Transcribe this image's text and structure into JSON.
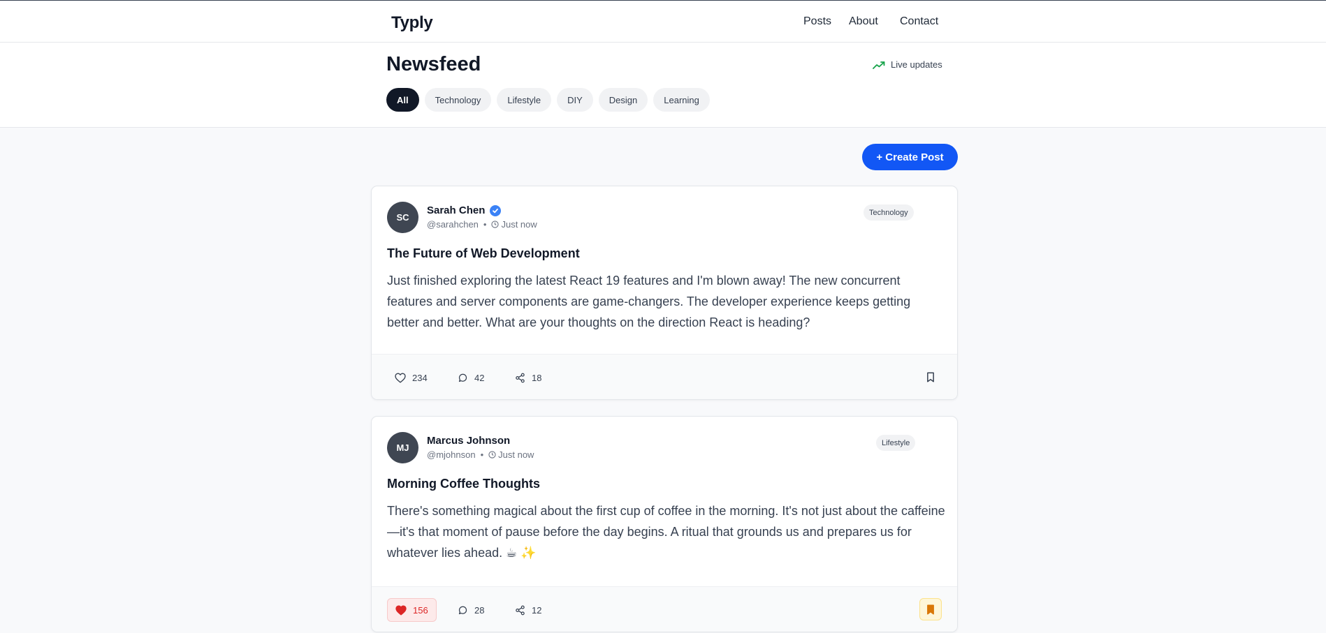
{
  "app": {
    "brand": "Typly"
  },
  "nav": {
    "links": [
      "Posts",
      "About",
      "Contact"
    ]
  },
  "header": {
    "title": "Newsfeed",
    "live_label": "Live updates",
    "filters": [
      "All",
      "Technology",
      "Lifestyle",
      "DIY",
      "Design",
      "Learning"
    ],
    "active_filter": "All"
  },
  "create_post_label": "+ Create Post",
  "posts": [
    {
      "initials": "SC",
      "author": "Sarah Chen",
      "verified": true,
      "handle": "@sarahchen",
      "time": "Just now",
      "category": "Technology",
      "title": "The Future of Web Development",
      "body": "Just finished exploring the latest React 19 features and I'm blown away! The new concurrent features and server components are game-changers. The developer experience keeps getting better and better. What are your thoughts on the direction React is heading?",
      "likes": "234",
      "comments": "42",
      "shares": "18",
      "liked": false,
      "bookmarked": false
    },
    {
      "initials": "MJ",
      "author": "Marcus Johnson",
      "verified": false,
      "handle": "@mjohnson",
      "time": "Just now",
      "category": "Lifestyle",
      "title": "Morning Coffee Thoughts",
      "body": "There's something magical about the first cup of coffee in the morning. It's not just about the caffeine—it's that moment of pause before the day begins. A ritual that grounds us and prepares us for whatever lies ahead. ☕ ✨",
      "likes": "156",
      "comments": "28",
      "shares": "12",
      "liked": true,
      "bookmarked": true
    }
  ],
  "colors": {
    "accent": "#1257f5",
    "liked": "#dc2626",
    "bookmark_saved": "#d97706",
    "live": "#16a34a",
    "verified": "#3b82f6"
  }
}
